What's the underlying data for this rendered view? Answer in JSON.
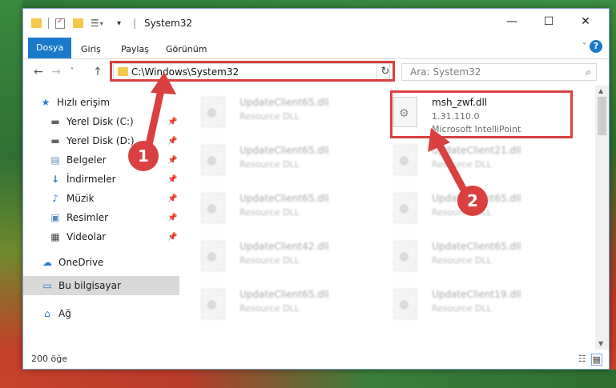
{
  "window": {
    "title": "System32",
    "quick_access_toolbar": {
      "separator": "|",
      "dropdown": "▾"
    },
    "controls": {
      "minimize": "—",
      "maximize": "☐",
      "close": "✕"
    }
  },
  "ribbon": {
    "tabs": [
      {
        "label": "Dosya",
        "active": true
      },
      {
        "label": "Giriş"
      },
      {
        "label": "Paylaş"
      },
      {
        "label": "Görünüm"
      }
    ],
    "expand_icon": "˅",
    "help_icon": "?"
  },
  "navigation": {
    "back": "←",
    "forward": "→",
    "recent": "˅",
    "up": "↑",
    "address": "C:\\Windows\\System32",
    "address_dropdown": "˅",
    "refresh": "↻",
    "search_placeholder": "Ara: System32",
    "search_icon": "⌕"
  },
  "sidebar": {
    "quick_access": "Hızlı erişim",
    "items": [
      {
        "label": "Yerel Disk (C:)",
        "icon": "drive-icon",
        "pinned": true
      },
      {
        "label": "Yerel Disk (D:)",
        "icon": "drive-icon",
        "pinned": true
      },
      {
        "label": "Belgeler",
        "icon": "documents-icon",
        "pinned": true
      },
      {
        "label": "İndirmeler",
        "icon": "download-icon",
        "pinned": true
      },
      {
        "label": "Müzik",
        "icon": "music-icon",
        "pinned": true
      },
      {
        "label": "Resimler",
        "icon": "pictures-icon",
        "pinned": true
      },
      {
        "label": "Videolar",
        "icon": "videos-icon",
        "pinned": true
      }
    ],
    "onedrive": "OneDrive",
    "this_pc": "Bu bilgisayar",
    "network": "Ağ"
  },
  "files": {
    "left_column": [
      {
        "name": "UpdateClient65.dll",
        "desc": "Resource DLL"
      },
      {
        "name": "UpdateClient65.dll",
        "desc": "Resource DLL"
      },
      {
        "name": "UpdateClient65.dll",
        "desc": "Resource DLL"
      },
      {
        "name": "UpdateClient42.dll",
        "desc": "Resource DLL"
      },
      {
        "name": "UpdateClient65.dll",
        "desc": "Resource DLL"
      }
    ],
    "right_column": [
      {
        "name": "msh_zwf.dll",
        "version": "1.31.110.0",
        "desc": "Microsoft IntelliPoint"
      },
      {
        "name": "UpdateClient21.dll",
        "desc": "Resource DLL"
      },
      {
        "name": "UpdateClient65.dll",
        "desc": "Resource DLL"
      },
      {
        "name": "UpdateClient65.dll",
        "desc": "Resource DLL"
      },
      {
        "name": "UpdateClient19.dll",
        "desc": "Resource DLL"
      }
    ]
  },
  "status": {
    "item_count": "200 öğe"
  },
  "annotations": {
    "badge1": "1",
    "badge2": "2",
    "color": "#d9403f"
  }
}
